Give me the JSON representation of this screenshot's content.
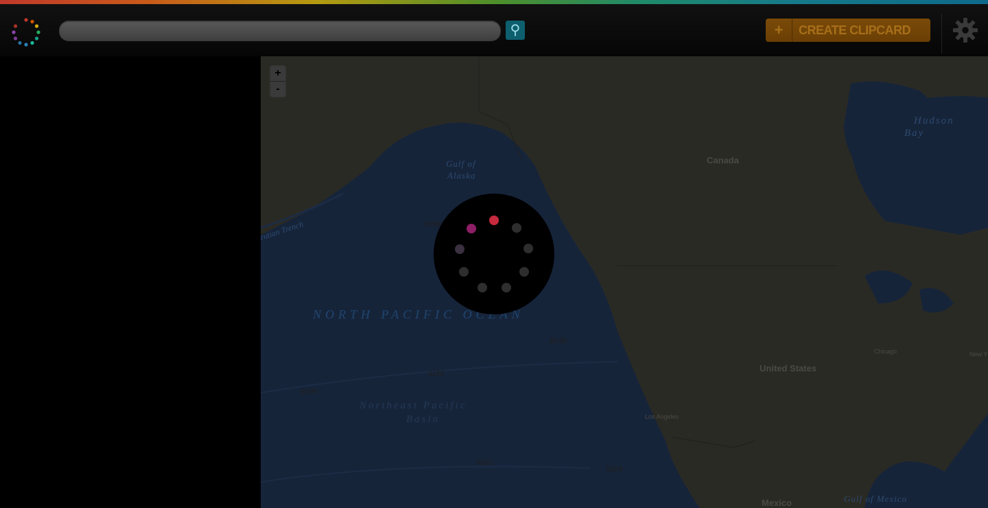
{
  "header": {
    "search": {
      "placeholder": "",
      "value": ""
    },
    "search_icon": "search-icon",
    "create_button": {
      "icon": "plus-icon",
      "label": "CREATE CLIPCARD"
    },
    "settings_icon": "gear-icon"
  },
  "map": {
    "zoom_in": "+",
    "zoom_out": "-",
    "labels": [
      {
        "text": "Hudson",
        "style": "water"
      },
      {
        "text": "Bay",
        "style": "water"
      },
      {
        "text": "Gulf of",
        "style": "water"
      },
      {
        "text": "Alaska",
        "style": "water"
      },
      {
        "text": "Canada",
        "style": "country"
      },
      {
        "text": "eutian Trench",
        "style": "feature"
      },
      {
        "text": "5058",
        "style": "depth"
      },
      {
        "text": "NORTH PACIFIC OCEAN",
        "style": "ocean"
      },
      {
        "text": "8238",
        "style": "depth"
      },
      {
        "text": "1152",
        "style": "depth"
      },
      {
        "text": "8195",
        "style": "depth"
      },
      {
        "text": "Northeast Pacific",
        "style": "basin"
      },
      {
        "text": "Basin",
        "style": "basin"
      },
      {
        "text": "9621",
        "style": "depth"
      },
      {
        "text": "5529",
        "style": "depth"
      },
      {
        "text": "United States",
        "style": "country"
      },
      {
        "text": "Chicago",
        "style": "city"
      },
      {
        "text": "New Y",
        "style": "city"
      },
      {
        "text": "Los Angeles",
        "style": "city"
      },
      {
        "text": "Mexico",
        "style": "country"
      },
      {
        "text": "Gulf of Mexico",
        "style": "water"
      }
    ]
  },
  "colors": {
    "accent_teal": "#0d5f6e",
    "button_orange": "#7a4a08",
    "spinner_red": "#c62a3c",
    "spinner_magenta": "#8e1e66",
    "spinner_gray": "#2e2e2e"
  }
}
